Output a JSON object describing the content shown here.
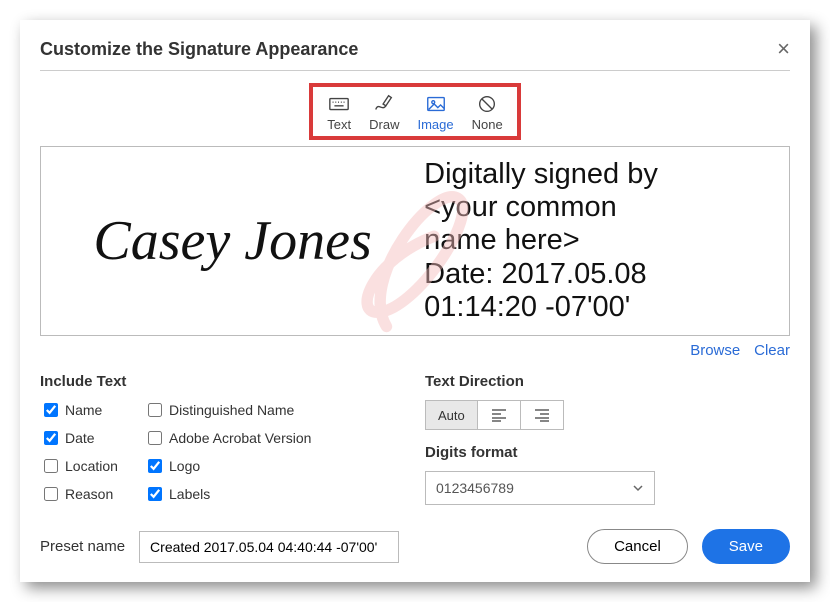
{
  "title": "Customize the Signature Appearance",
  "tabs": {
    "text": "Text",
    "draw": "Draw",
    "image": "Image",
    "none": "None"
  },
  "preview": {
    "signature_name": "Casey Jones",
    "details": "Digitally signed by\n<your common\nname here>\nDate: 2017.05.08\n01:14:20 -07'00'",
    "browse": "Browse",
    "clear": "Clear"
  },
  "include": {
    "label": "Include Text",
    "name": {
      "label": "Name",
      "checked": true
    },
    "distinguished": {
      "label": "Distinguished Name",
      "checked": false
    },
    "date": {
      "label": "Date",
      "checked": true
    },
    "acrobat_version": {
      "label": "Adobe Acrobat Version",
      "checked": false
    },
    "location": {
      "label": "Location",
      "checked": false
    },
    "logo": {
      "label": "Logo",
      "checked": true
    },
    "reason": {
      "label": "Reason",
      "checked": false
    },
    "labels": {
      "label": "Labels",
      "checked": true
    }
  },
  "direction": {
    "label": "Text Direction",
    "auto": "Auto"
  },
  "digits": {
    "label": "Digits format",
    "selected": "0123456789"
  },
  "preset": {
    "label": "Preset name",
    "value": "Created 2017.05.04 04:40:44 -07'00'"
  },
  "buttons": {
    "cancel": "Cancel",
    "save": "Save"
  }
}
